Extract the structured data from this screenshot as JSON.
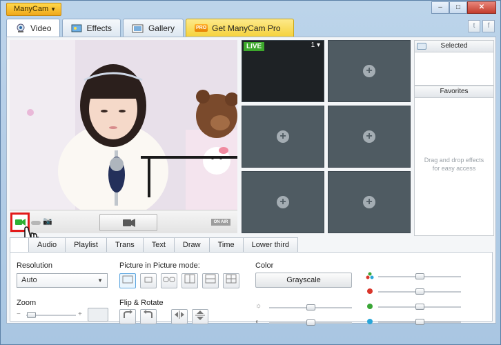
{
  "app": {
    "menu_label": "ManyCam"
  },
  "window": {
    "min": "–",
    "max": "□",
    "close": "✕"
  },
  "tabs": [
    {
      "label": "Video",
      "icon": "webcam-icon"
    },
    {
      "label": "Effects",
      "icon": "effects-icon"
    },
    {
      "label": "Gallery",
      "icon": "gallery-icon"
    },
    {
      "label": "Get ManyCam Pro",
      "badge": "PRO"
    }
  ],
  "social": {
    "twitter": "t",
    "facebook": "f"
  },
  "preview": {
    "on_air": "ON AIR"
  },
  "sources": {
    "live_label": "LIVE",
    "channel": "1 ▾",
    "add_symbol": "+"
  },
  "panels": {
    "selected_title": "Selected",
    "favorites_title": "Favorites",
    "favorites_hint_line1": "Drag and drop effects",
    "favorites_hint_line2": "for easy access"
  },
  "sub_tabs": [
    "",
    "Audio",
    "Playlist",
    "Trans",
    "Text",
    "Draw",
    "Time",
    "Lower third"
  ],
  "settings": {
    "resolution_label": "Resolution",
    "resolution_value": "Auto",
    "zoom_label": "Zoom",
    "zoom_minus": "−",
    "zoom_plus": "+",
    "pip_label": "Picture in Picture mode:",
    "flip_label": "Flip & Rotate",
    "color_label": "Color",
    "grayscale_label": "Grayscale"
  },
  "sliders": {
    "zoom": 0.1,
    "brightness": 0.5,
    "contrast": 0.5,
    "all_channels": 0.5,
    "red": 0.5,
    "green": 0.5,
    "blue": 0.5
  },
  "colors": {
    "red_dot": "#d9362b",
    "green_dot": "#3aa636",
    "blue_dot": "#2aa6d8",
    "live_green": "#3da82c",
    "highlight_red": "#e21a1a"
  }
}
